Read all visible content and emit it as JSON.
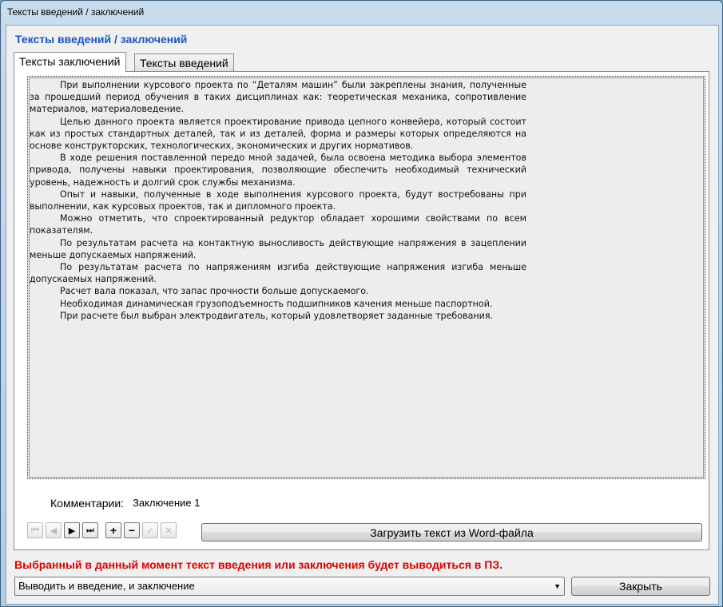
{
  "window": {
    "title": "Тексты введений / заключений"
  },
  "header": {
    "title": "Тексты введений / заключений"
  },
  "tabs": [
    {
      "label": "Тексты заключений",
      "active": true
    },
    {
      "label": "Тексты введений",
      "active": false
    }
  ],
  "content": {
    "paragraphs": [
      "При выполнении курсового проекта по “Деталям машин” были закреплены знания, полученные за прошедший период обучения в таких дисциплинах как: теоретическая механика, сопротивление материалов, материаловедение.",
      "Целью данного проекта является проектирование привода цепного конвейера, который состоит как из простых стандартных деталей, так и из деталей, форма и размеры которых определяются на основе конструкторских, технологических, экономических и других нормативов.",
      "В ходе решения поставленной передо мной задачей, была освоена методика выбора элементов привода, получены навыки проектирования, позволяющие обеспечить необходимый технический уровень, надежность и долгий срок службы механизма.",
      "Опыт и навыки, полученные в ходе выполнения курсового проекта, будут востребованы при выполнении, как курсовых проектов, так и дипломного проекта.",
      "Можно отметить, что спроектированный редуктор обладает хорошими свойствами по всем показателям.",
      "По результатам расчета на контактную выносливость действующие напряжения в зацеплении меньше допускаемых напряжений.",
      "По результатам расчета по напряжениям изгиба действующие напряжения изгиба меньше допускаемых напряжений.",
      "Расчет вала показал, что запас прочности больше допускаемого.",
      "Необходимая динамическая грузоподъемность подшипников качения меньше паспортной.",
      "При расчете был выбран электродвигатель, который удовлетворяет заданные требования."
    ]
  },
  "comment": {
    "label": "Комментарии:",
    "value": "Заключение 1"
  },
  "navigator": {
    "first": "⏮",
    "prior": "◀",
    "next": "▶",
    "last": "⏭",
    "insert": "+",
    "delete": "−",
    "post": "✓",
    "cancel": "✕"
  },
  "buttons": {
    "load_word": "Загрузить текст из Word-файла",
    "close": "Закрыть"
  },
  "warning": "Выбранный в данный момент текст введения или заключения будет выводиться в ПЗ.",
  "output_select": {
    "value": "Выводить и введение, и заключение"
  },
  "colors": {
    "header": "#1a56c8",
    "warning": "#e00000"
  }
}
